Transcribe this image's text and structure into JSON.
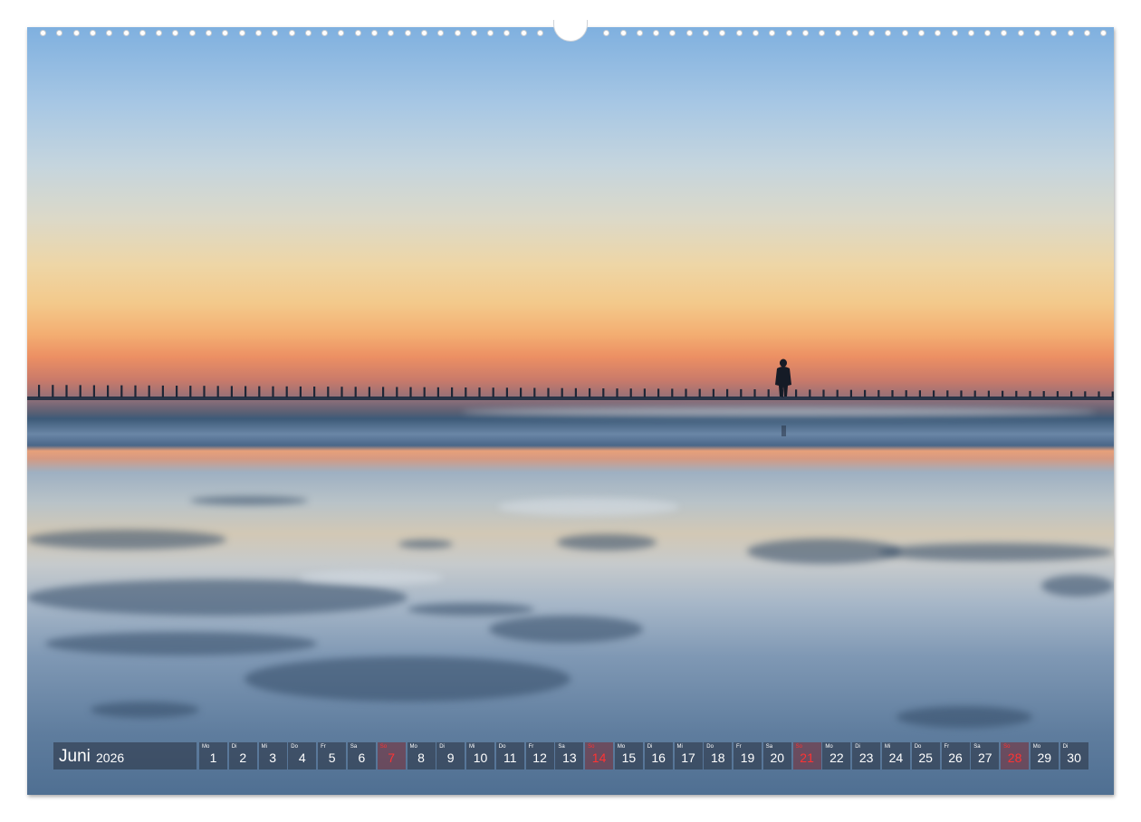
{
  "calendar": {
    "month": "Juni",
    "year": "2026",
    "days": [
      {
        "dow": "Mo",
        "day": "1"
      },
      {
        "dow": "Di",
        "day": "2"
      },
      {
        "dow": "Mi",
        "day": "3"
      },
      {
        "dow": "Do",
        "day": "4"
      },
      {
        "dow": "Fr",
        "day": "5"
      },
      {
        "dow": "Sa",
        "day": "6"
      },
      {
        "dow": "So",
        "day": "7"
      },
      {
        "dow": "Mo",
        "day": "8"
      },
      {
        "dow": "Di",
        "day": "9"
      },
      {
        "dow": "Mi",
        "day": "10"
      },
      {
        "dow": "Do",
        "day": "11"
      },
      {
        "dow": "Fr",
        "day": "12"
      },
      {
        "dow": "Sa",
        "day": "13"
      },
      {
        "dow": "So",
        "day": "14"
      },
      {
        "dow": "Mo",
        "day": "15"
      },
      {
        "dow": "Di",
        "day": "16"
      },
      {
        "dow": "Mi",
        "day": "17"
      },
      {
        "dow": "Do",
        "day": "18"
      },
      {
        "dow": "Fr",
        "day": "19"
      },
      {
        "dow": "Sa",
        "day": "20"
      },
      {
        "dow": "So",
        "day": "21"
      },
      {
        "dow": "Mo",
        "day": "22"
      },
      {
        "dow": "Di",
        "day": "23"
      },
      {
        "dow": "Mi",
        "day": "24"
      },
      {
        "dow": "Do",
        "day": "25"
      },
      {
        "dow": "Fr",
        "day": "26"
      },
      {
        "dow": "Sa",
        "day": "27"
      },
      {
        "dow": "So",
        "day": "28"
      },
      {
        "dow": "Mo",
        "day": "29"
      },
      {
        "dow": "Di",
        "day": "30"
      }
    ]
  },
  "colors": {
    "sunday_text": "#ff3333",
    "cell_background": "#283040"
  }
}
